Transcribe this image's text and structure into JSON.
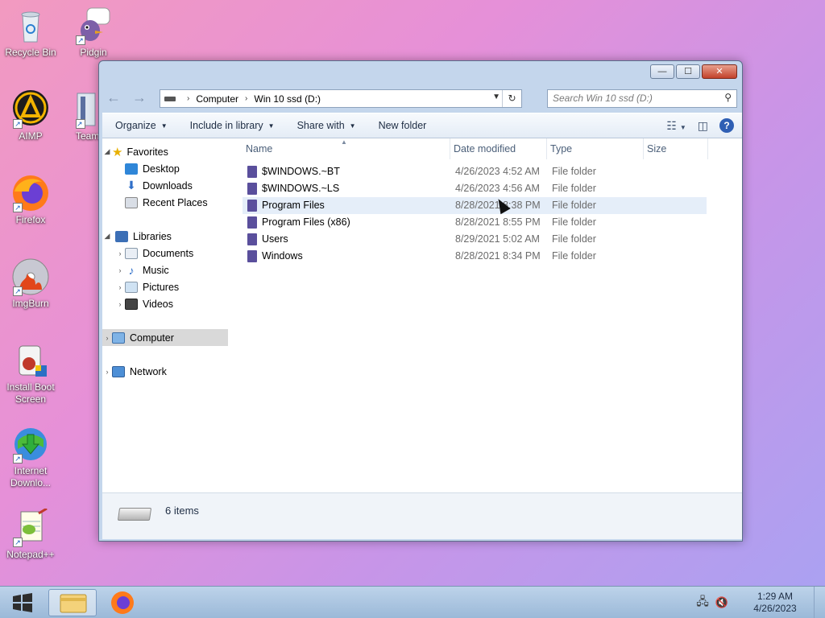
{
  "desktop": {
    "icons": [
      {
        "label": "Recycle Bin",
        "icon": "recycle-bin-icon"
      },
      {
        "label": "Pidgin",
        "icon": "pidgin-icon"
      },
      {
        "label": "AIMP",
        "icon": "aimp-icon"
      },
      {
        "label": "Team",
        "icon": "teamviewer-icon"
      },
      {
        "label": "Firefox",
        "icon": "firefox-icon"
      },
      {
        "label": "ImgBurn",
        "icon": "imgburn-icon"
      },
      {
        "label": "Install Boot Screen",
        "icon": "install-boot-screen-icon"
      },
      {
        "label": "Internet Downlo...",
        "icon": "internet-download-manager-icon"
      },
      {
        "label": "Notepad++",
        "icon": "notepad-plus-plus-icon"
      }
    ]
  },
  "window": {
    "controls": {
      "minimize": "—",
      "maximize": "☐",
      "close": "✕"
    },
    "address": {
      "crumbs": [
        "Computer",
        "Win 10 ssd (D:)"
      ],
      "refresh": "↻",
      "back": "←",
      "forward": "→"
    },
    "search": {
      "placeholder": "Search Win 10 ssd (D:)"
    },
    "toolbar": {
      "organize": "Organize",
      "include_in_library": "Include in library",
      "share_with": "Share with",
      "new_folder": "New folder",
      "help": "?"
    },
    "nav": {
      "favorites": "Favorites",
      "desktop": "Desktop",
      "downloads": "Downloads",
      "recent_places": "Recent Places",
      "libraries": "Libraries",
      "documents": "Documents",
      "music": "Music",
      "pictures": "Pictures",
      "videos": "Videos",
      "computer": "Computer",
      "network": "Network"
    },
    "columns": {
      "name": "Name",
      "date_modified": "Date modified",
      "type": "Type",
      "size": "Size"
    },
    "files": [
      {
        "name": "$WINDOWS.~BT",
        "date": "4/26/2023 4:52 AM",
        "type": "File folder"
      },
      {
        "name": "$WINDOWS.~LS",
        "date": "4/26/2023 4:56 AM",
        "type": "File folder"
      },
      {
        "name": "Program Files",
        "date": "8/28/2021 8:38 PM",
        "type": "File folder"
      },
      {
        "name": "Program Files (x86)",
        "date": "8/28/2021 8:55 PM",
        "type": "File folder"
      },
      {
        "name": "Users",
        "date": "8/29/2021 5:02 AM",
        "type": "File folder"
      },
      {
        "name": "Windows",
        "date": "8/28/2021 8:34 PM",
        "type": "File folder"
      }
    ],
    "status": {
      "item_count": "6 items"
    }
  },
  "taskbar": {
    "time": "1:29 AM",
    "date": "4/26/2023"
  },
  "colors": {
    "folder": "#5a4f9c",
    "selected_nav": "#d9d9d9",
    "hover_row": "#e5eef9"
  }
}
